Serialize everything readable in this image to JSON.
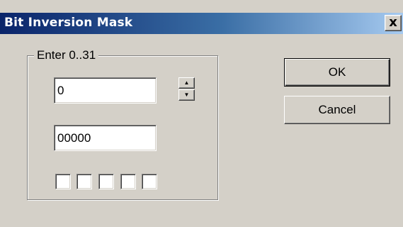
{
  "window": {
    "title": "Bit Inversion Mask",
    "close_glyph": "x",
    "titlebar_colors": [
      "#0a246a",
      "#a6caf0"
    ]
  },
  "group": {
    "label": "Enter 0..31"
  },
  "decimal_field": {
    "value": "0"
  },
  "spinner": {
    "up_icon": "▲",
    "down_icon": "▼"
  },
  "binary_field": {
    "value": "00000"
  },
  "bit_checkboxes": [
    false,
    false,
    false,
    false,
    false
  ],
  "buttons": {
    "ok_label": "OK",
    "cancel_label": "Cancel"
  }
}
